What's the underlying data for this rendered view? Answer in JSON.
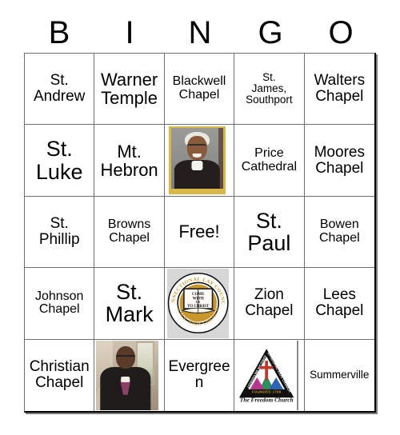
{
  "card": {
    "header_letters": [
      "B",
      "I",
      "N",
      "G",
      "O"
    ],
    "free_space_label": "Free!",
    "rows": [
      [
        {
          "type": "text",
          "label": "St. Andrew",
          "lines": [
            "St.",
            "Andrew"
          ],
          "size": "md"
        },
        {
          "type": "text",
          "label": "Warner Temple",
          "lines": [
            "Warner",
            "Temple"
          ],
          "size": "lg"
        },
        {
          "type": "text",
          "label": "Blackwell Chapel",
          "lines": [
            "Blackwell",
            "Chapel"
          ],
          "size": "sm"
        },
        {
          "type": "text",
          "label": "St. James, Southport",
          "lines": [
            "St.",
            "James,",
            "Southport"
          ],
          "size": "xs"
        },
        {
          "type": "text",
          "label": "Walters Chapel",
          "lines": [
            "Walters",
            "Chapel"
          ],
          "size": "md"
        }
      ],
      [
        {
          "type": "text",
          "label": "St. Luke",
          "lines": [
            "St.",
            "Luke"
          ],
          "size": "xl"
        },
        {
          "type": "text",
          "label": "Mt. Hebron",
          "lines": [
            "Mt.",
            "Hebron"
          ],
          "size": "lg"
        },
        {
          "type": "image",
          "label": "bishop-portrait-gold-frame",
          "alt": "Portrait of a smiling bishop with white hair and glasses in dark clerical attire, gold frame"
        },
        {
          "type": "text",
          "label": "Price Cathedral",
          "lines": [
            "Price",
            "Cathedral"
          ],
          "size": "sm"
        },
        {
          "type": "text",
          "label": "Moores Chapel",
          "lines": [
            "Moores",
            "Chapel"
          ],
          "size": "md"
        }
      ],
      [
        {
          "type": "text",
          "label": "St. Phillip",
          "lines": [
            "St.",
            "Phillip"
          ],
          "size": "md"
        },
        {
          "type": "text",
          "label": "Browns Chapel",
          "lines": [
            "Browns",
            "Chapel"
          ],
          "size": "sm"
        },
        {
          "type": "free",
          "label": "Free!",
          "lines": [
            "Free!"
          ],
          "size": "lg"
        },
        {
          "type": "text",
          "label": "St. Paul",
          "lines": [
            "St.",
            "Paul"
          ],
          "size": "xl"
        },
        {
          "type": "text",
          "label": "Bowen Chapel",
          "lines": [
            "Bowen",
            "Chapel"
          ],
          "size": "sm"
        }
      ],
      [
        {
          "type": "text",
          "label": "Johnson Chapel",
          "lines": [
            "Johnson",
            "Chapel"
          ],
          "size": "sm"
        },
        {
          "type": "text",
          "label": "St. Mark",
          "lines": [
            "St.",
            "Mark"
          ],
          "size": "xl"
        },
        {
          "type": "seal",
          "label": "connectional-lay-council-seal",
          "alt": "Circular seal of the Connectional Lay Council"
        },
        {
          "type": "text",
          "label": "Zion Chapel",
          "lines": [
            "Zion",
            "Chapel"
          ],
          "size": "md"
        },
        {
          "type": "text",
          "label": "Lees Chapel",
          "lines": [
            "Lees",
            "Chapel"
          ],
          "size": "md"
        }
      ],
      [
        {
          "type": "text",
          "label": "Christian Chapel",
          "lines": [
            "Christian",
            "Chapel"
          ],
          "size": "md"
        },
        {
          "type": "image",
          "label": "bishop-portrait-interior",
          "alt": "Portrait of a bishop in dark suit with purple clerical shirt in an interior room"
        },
        {
          "type": "text",
          "label": "Evergreen",
          "lines": [
            "Evergreen"
          ],
          "size": "md"
        },
        {
          "type": "logo",
          "label": "ame-zion-triangle-logo",
          "alt": "AME Zion Church triangular logo"
        },
        {
          "type": "text",
          "label": "Summerville",
          "lines": [
            "Summerville"
          ],
          "size": "xs"
        }
      ]
    ]
  },
  "seal": {
    "outer_top_text": "CONNECTIONAL LAY COUNCIL",
    "outer_bottom_text": "A.M.E. ZION CHURCH",
    "book_lines": [
      "COME",
      "WITH",
      "US",
      "TO CHRIST"
    ],
    "gold": "#C8962A",
    "ring": "#ffffff",
    "outline": "#111111"
  },
  "logo": {
    "edge_text_left": "AFRICAN METHODIST",
    "edge_text_right": "EPISCOPAL ZION CHURCH",
    "band_text": "FOUNDED 1796",
    "tagline": "The Freedom Church",
    "cross_color": "#c0392b",
    "mountain_colors": [
      "#b8368f",
      "#2f8f5b",
      "#2b64b5"
    ]
  },
  "colors": {
    "background": "#ffffff",
    "grid_line": "#6e6e6e",
    "grid_outer": "#000000",
    "text": "#000000",
    "shadow": "#7c7c7c"
  }
}
